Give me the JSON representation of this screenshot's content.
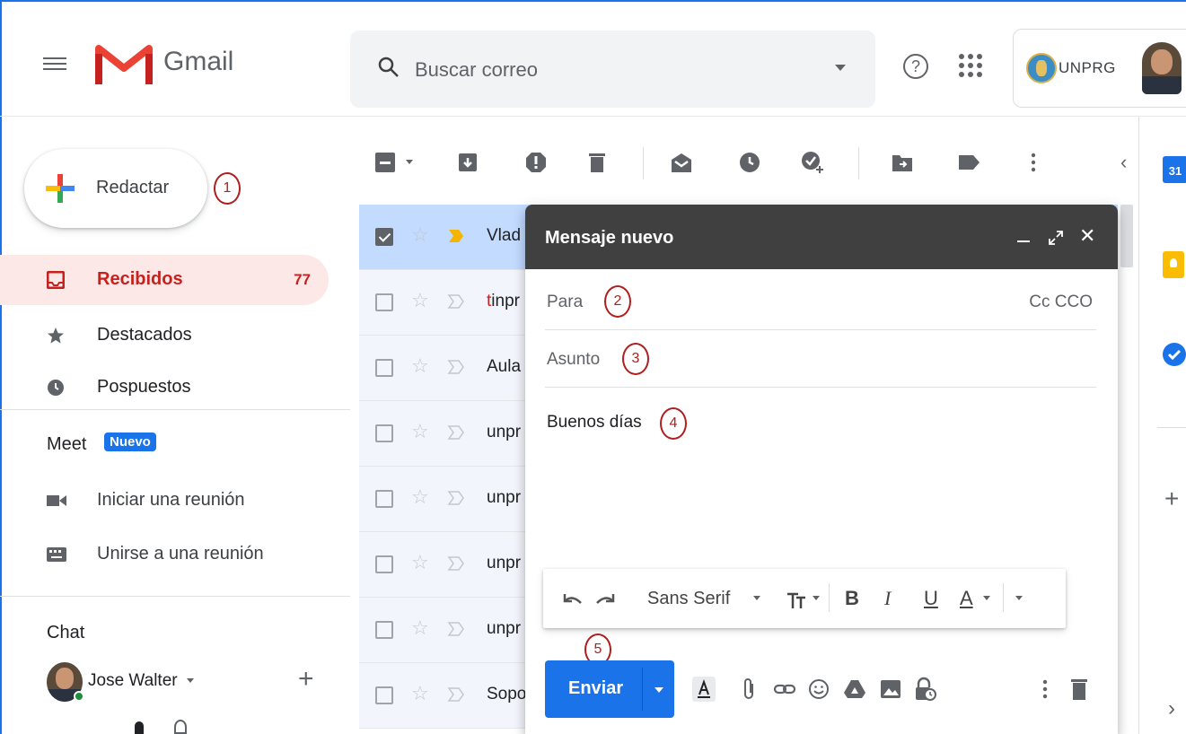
{
  "header": {
    "brand": "Gmail",
    "search_placeholder": "Buscar correo",
    "help_glyph": "?",
    "account_org": "UNPRG"
  },
  "sidebar": {
    "compose_label": "Redactar",
    "nav": [
      {
        "label": "Recibidos",
        "count": "77",
        "active": true
      },
      {
        "label": "Destacados"
      },
      {
        "label": "Pospuestos"
      }
    ],
    "meet": {
      "heading": "Meet",
      "badge": "Nuevo",
      "items": [
        {
          "label": "Iniciar una reunión"
        },
        {
          "label": "Unirse a una reunión"
        }
      ]
    },
    "chat": {
      "heading": "Chat",
      "user_name": "Jose Walter",
      "add_glyph": "+"
    }
  },
  "annotations": [
    "1",
    "2",
    "3",
    "4",
    "5"
  ],
  "email_list": {
    "rows": [
      {
        "sender": "Vlad",
        "selected": true
      },
      {
        "sender_prefix": "t",
        "sender": "inpr",
        "selected": false
      },
      {
        "sender": "Aula",
        "selected": false
      },
      {
        "sender": "unpr",
        "selected": false
      },
      {
        "sender": "unpr",
        "selected": false
      },
      {
        "sender": "unpr",
        "selected": false
      },
      {
        "sender": "unpr",
        "selected": false
      },
      {
        "sender": "Sopo",
        "selected": false
      }
    ]
  },
  "compose": {
    "title": "Mensaje nuevo",
    "to_label": "Para",
    "cc_bcc": "Cc CCO",
    "subject_label": "Asunto",
    "body": "Buenos días",
    "font_name": "Sans Serif",
    "send_label": "Enviar",
    "format": {
      "bold": "B",
      "italic": "I",
      "underline": "U",
      "text_color": "A"
    },
    "close_glyph": "✕"
  },
  "right_panel": {
    "calendar_day": "31",
    "add_glyph": "+"
  },
  "colors": {
    "accent": "#1a73e8",
    "inbox_active": "#c5221f",
    "compose_header": "#404040",
    "annotation": "#b01e1e"
  }
}
